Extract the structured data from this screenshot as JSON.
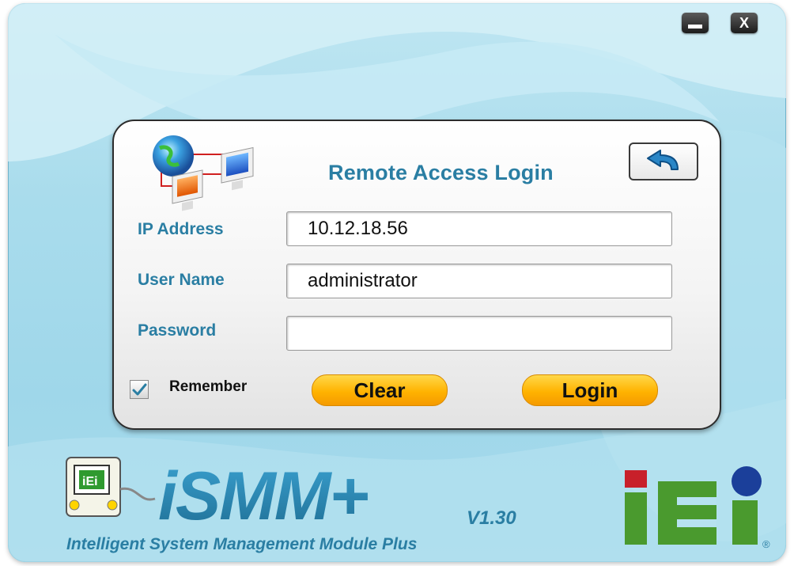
{
  "window": {
    "minimize_label": "",
    "close_label": "X"
  },
  "login_panel": {
    "title": "Remote Access Login",
    "fields": {
      "ip_address": {
        "label": "IP Address",
        "value": "10.12.18.56"
      },
      "user_name": {
        "label": "User Name",
        "value": "administrator"
      },
      "password": {
        "label": "Password",
        "value": ""
      }
    },
    "remember": {
      "label": "Remember",
      "checked": true
    },
    "buttons": {
      "clear": "Clear",
      "login": "Login"
    },
    "icons": [
      "network-icon",
      "back-arrow-icon",
      "checkmark-icon"
    ]
  },
  "branding": {
    "product_logo_text": "iSMM+",
    "version": "V1.30",
    "subtitle": "Intelligent System Management Module Plus",
    "company_logo_text": "iEi",
    "registered_mark": "®"
  },
  "colors": {
    "accent": "#2a7ea3",
    "button": "#ffb300",
    "background": "#a9dcec",
    "iei_green": "#4a9a2e",
    "iei_red": "#c8202a",
    "iei_blue": "#1b3f9a"
  }
}
